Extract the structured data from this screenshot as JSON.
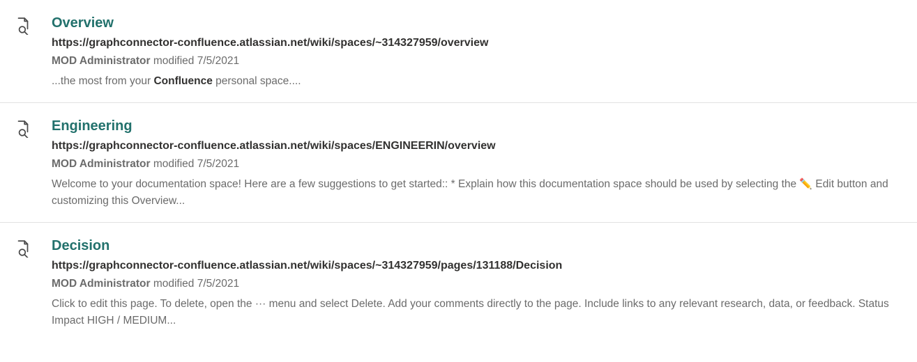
{
  "results": [
    {
      "title": "Overview",
      "url": "https://graphconnector-confluence.atlassian.net/wiki/spaces/~314327959/overview",
      "author": "MOD Administrator",
      "modified_label": "modified",
      "modified_date": "7/5/2021",
      "snippet_pre": "...the most from your ",
      "snippet_bold": "Confluence",
      "snippet_post": " personal space....",
      "pencil": false
    },
    {
      "title": "Engineering",
      "url": "https://graphconnector-confluence.atlassian.net/wiki/spaces/ENGINEERIN/overview",
      "author": "MOD Administrator",
      "modified_label": "modified",
      "modified_date": "7/5/2021",
      "snippet_pre": "Welcome to your documentation space! Here are a few suggestions to get started:: * Explain how this documentation space should be used by selecting the ",
      "snippet_bold": "",
      "snippet_post": " Edit button and customizing this Overview...",
      "pencil": true
    },
    {
      "title": "Decision",
      "url": "https://graphconnector-confluence.atlassian.net/wiki/spaces/~314327959/pages/131188/Decision",
      "author": "MOD Administrator",
      "modified_label": "modified",
      "modified_date": "7/5/2021",
      "snippet_pre": "Click to edit this page. To delete, open the ··· menu and select Delete. Add your comments directly to the page. Include links to any relevant research, data, or feedback. Status Impact HIGH / MEDIUM...",
      "snippet_bold": "",
      "snippet_post": "",
      "pencil": false
    }
  ]
}
